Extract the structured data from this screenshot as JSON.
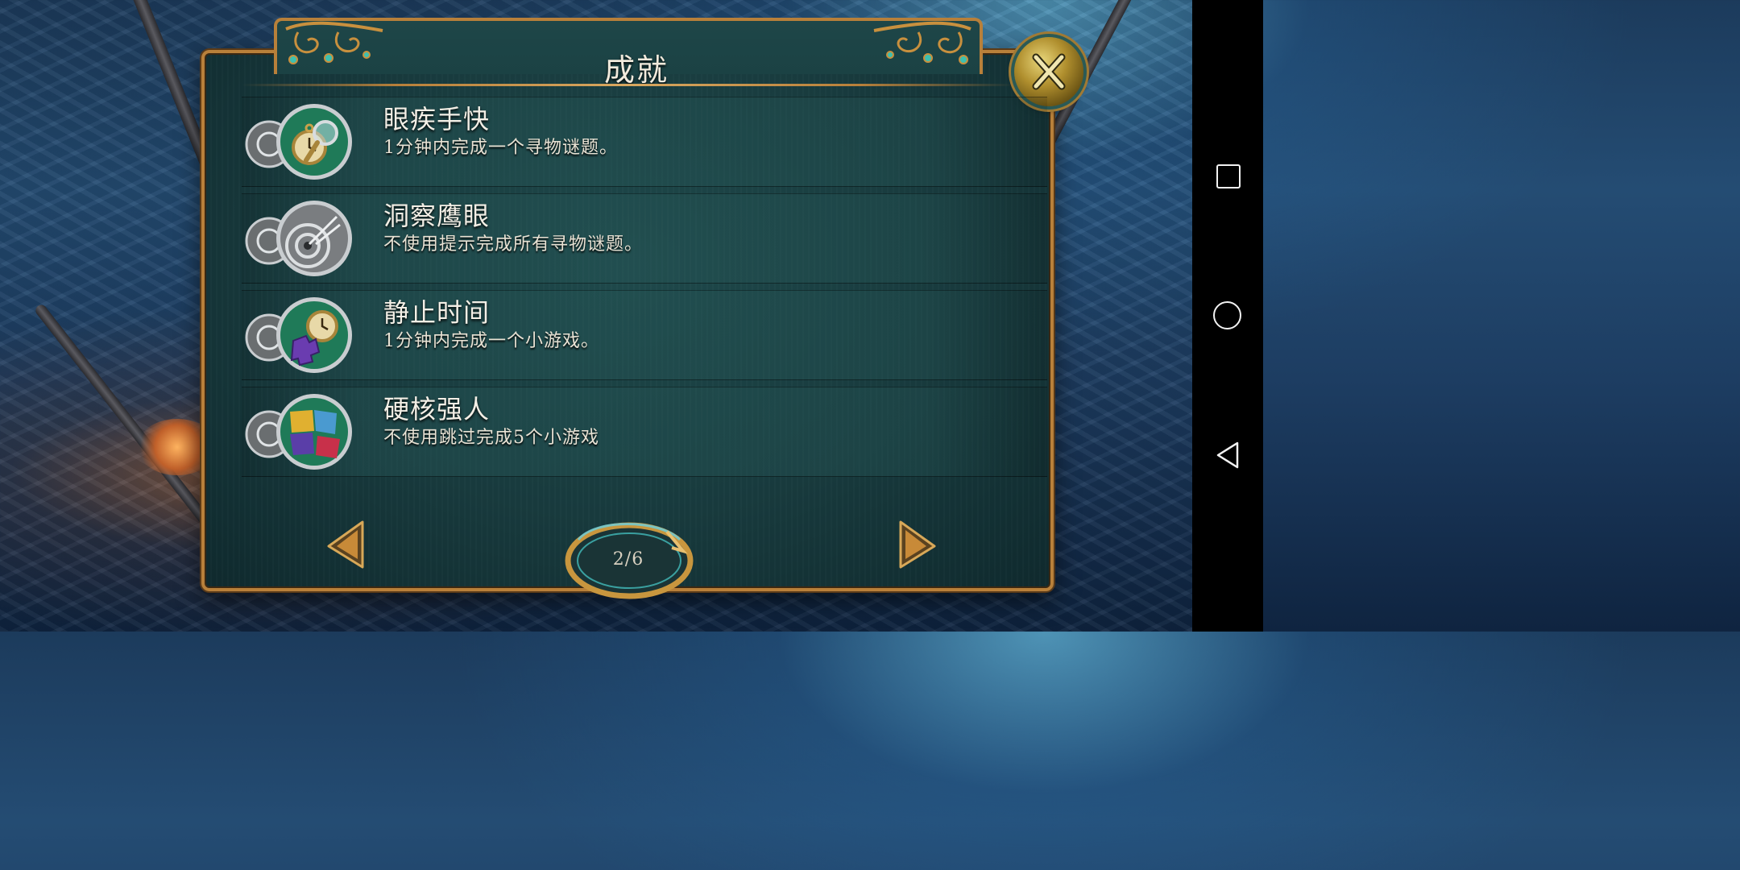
{
  "dialog": {
    "title": "成就",
    "close_label": "X"
  },
  "achievements": [
    {
      "title": "眼疾手快",
      "description": "1分钟内完成一个寻物谜题。",
      "icon": "pocket-watch-magnifier-icon"
    },
    {
      "title": "洞察鹰眼",
      "description": "不使用提示完成所有寻物谜题。",
      "icon": "eye-target-icon"
    },
    {
      "title": "静止时间",
      "description": "1分钟内完成一个小游戏。",
      "icon": "pocket-watch-puzzle-icon"
    },
    {
      "title": "硬核强人",
      "description": "不使用跳过完成5个小游戏",
      "icon": "puzzle-pieces-icon"
    }
  ],
  "pagination": {
    "current": 2,
    "total": 6,
    "label": "2/6"
  },
  "system_nav": {
    "buttons": [
      "recent-apps",
      "home",
      "back"
    ]
  },
  "colors": {
    "frame_gold": "#b8803a",
    "panel_teal": "#1b4244",
    "text": "#f3efe6"
  }
}
